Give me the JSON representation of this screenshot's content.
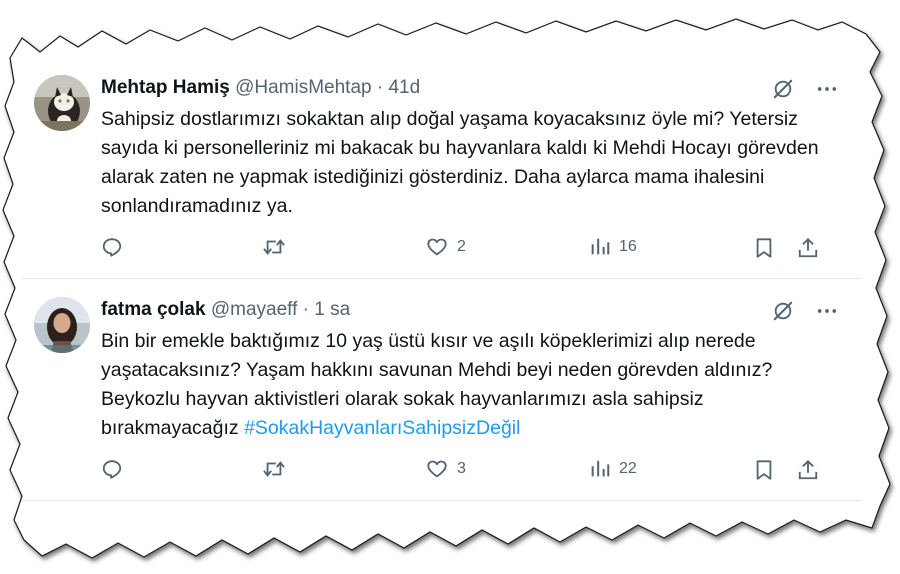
{
  "tweets": [
    {
      "name": "Mehtap Hamiş",
      "handle": "@HamisMehtap",
      "sep": "·",
      "time": "41d",
      "text": "Sahipsiz dostlarımızı sokaktan alıp doğal yaşama koyacaksınız öyle mi? Yetersiz sayıda ki personelleriniz mi bakacak bu hayvanlara kaldı ki Mehdi Hocayı görevden alarak zaten ne yapmak istediğinizi gösterdiniz. Daha aylarca mama ihalesini sonlandıramadınız ya.",
      "hashtag": "",
      "likes": "2",
      "views": "16"
    },
    {
      "name": "fatma çolak",
      "handle": "@mayaeff",
      "sep": "·",
      "time": "1 sa",
      "text": "Bin bir emekle baktığımız 10 yaş üstü kısır ve aşılı köpeklerimizi alıp nerede yaşatacaksınız? Yaşam hakkını savunan Mehdi beyi neden görevden aldınız? Beykozlu hayvan aktivistleri olarak sokak hayvanlarımızı asla sahipsiz bırakmayacağız ",
      "hashtag": "#SokakHayvanlarıSahipsizDeğil",
      "likes": "3",
      "views": "22"
    }
  ],
  "colors": {
    "text": "#0f1419",
    "muted": "#536471",
    "link": "#1d9bf0",
    "divider": "#e4e8eb"
  },
  "icons": [
    "grok-icon",
    "more-icon",
    "reply-icon",
    "retweet-icon",
    "like-icon",
    "views-icon",
    "bookmark-icon",
    "share-icon"
  ]
}
